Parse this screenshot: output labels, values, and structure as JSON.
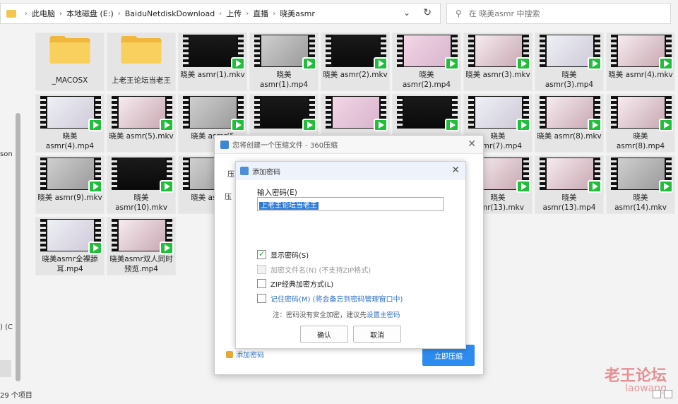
{
  "address": {
    "crumbs": [
      "此电脑",
      "本地磁盘 (E:)",
      "BaiduNetdiskDownload",
      "上传",
      "直播",
      "晓美asmr"
    ]
  },
  "search": {
    "placeholder": "在 晓美asmr 中搜索"
  },
  "nav": {
    "partial_label_1": "son",
    "partial_label_2": ") (C"
  },
  "status": {
    "count": "29 个项目"
  },
  "files": [
    {
      "label": "_MACOSX",
      "type": "folder"
    },
    {
      "label": "上老王论坛当老王",
      "type": "folder"
    },
    {
      "label": "晓美 asmr(1).mkv",
      "type": "video",
      "tone": "dark"
    },
    {
      "label": "晓美 asmr(1).mp4",
      "type": "video",
      "tone": "gray"
    },
    {
      "label": "晓美 asmr(2).mkv",
      "type": "video",
      "tone": "dark"
    },
    {
      "label": "晓美 asmr(2).mp4",
      "type": "video",
      "tone": "pink"
    },
    {
      "label": "晓美 asmr(3).mkv",
      "type": "video",
      "tone": "light"
    },
    {
      "label": "晓美 asmr(3).mp4",
      "type": "video",
      "tone": "tripod"
    },
    {
      "label": "晓美 asmr(4).mkv",
      "type": "video",
      "tone": "light"
    },
    {
      "label": "晓美 asmr(4).mp4",
      "type": "video",
      "tone": "tripod"
    },
    {
      "label": "晓美 asmr(5).mkv",
      "type": "video",
      "tone": "light"
    },
    {
      "label": "晓美 asmr(5",
      "type": "video",
      "tone": "gray"
    },
    {
      "label": "",
      "type": "video",
      "tone": "dark"
    },
    {
      "label": "",
      "type": "video",
      "tone": "pink"
    },
    {
      "label": "",
      "type": "video",
      "tone": "dark"
    },
    {
      "label": "晓美 asmr(7).mp4",
      "type": "video",
      "tone": "tripod"
    },
    {
      "label": "晓美 asmr(8).mkv",
      "type": "video",
      "tone": "light"
    },
    {
      "label": "晓美 asmr(8).mp4",
      "type": "video",
      "tone": "light"
    },
    {
      "label": "晓美 asmr(9).mkv",
      "type": "video",
      "tone": "gray"
    },
    {
      "label": "晓美 asmr(10).mkv",
      "type": "video",
      "tone": "dark"
    },
    {
      "label": "晓美 asmr(1",
      "type": "video",
      "tone": "gray"
    },
    {
      "label": "",
      "type": "video",
      "tone": "gray"
    },
    {
      "label": "",
      "type": "video",
      "tone": "gray"
    },
    {
      "label": "",
      "type": "video",
      "tone": "gray"
    },
    {
      "label": "晓美 asmr(13).mkv",
      "type": "video",
      "tone": "light"
    },
    {
      "label": "晓美 asmr(13).mp4",
      "type": "video",
      "tone": "light"
    },
    {
      "label": "晓美 asmr(14).mkv",
      "type": "video",
      "tone": "gray"
    },
    {
      "label": "晓美asmr全裸舔耳.mp4",
      "type": "video",
      "tone": "tripod"
    },
    {
      "label": "晓美asmr双人同时预览.mp4",
      "type": "video",
      "tone": "light"
    }
  ],
  "win360": {
    "title": "您将创建一个压缩文件 - 360压缩",
    "partial_1": "压",
    "partial_2": "压",
    "add_password": "添加密码",
    "go_button": "立即压缩"
  },
  "pwd_dialog": {
    "title": "添加密码",
    "input_label": "输入密码(E)",
    "input_value": "上老王论坛当老王",
    "options": [
      {
        "label": "显示密码(S)",
        "checked": true,
        "state": "normal"
      },
      {
        "label": "加密文件名(N) (不支持ZIP格式)",
        "checked": false,
        "state": "disabled"
      },
      {
        "label": "ZIP经典加密方式(L)",
        "checked": false,
        "state": "normal"
      },
      {
        "label": "记住密码(M) (将会备忘到密码管理窗口中)",
        "checked": false,
        "state": "blue"
      }
    ],
    "note_prefix": "注：密码没有安全加密，建议先",
    "note_link": "设置主密码",
    "ok": "确认",
    "cancel": "取消"
  },
  "watermark": {
    "line1": "老王论坛",
    "line2": "laowang"
  }
}
